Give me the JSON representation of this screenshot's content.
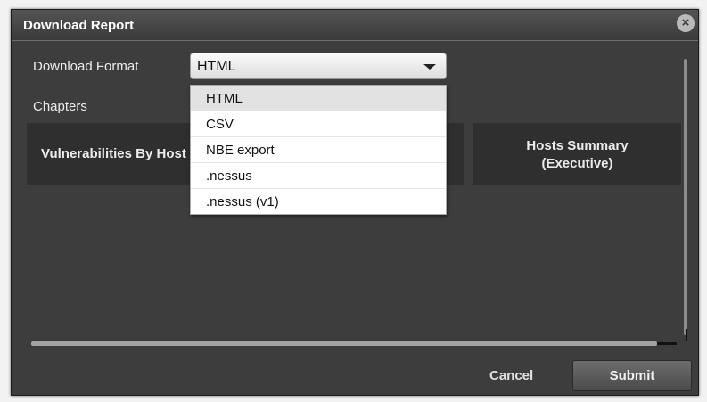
{
  "dialog": {
    "title": "Download Report",
    "close_icon": "close-icon",
    "close_glyph": "×"
  },
  "format": {
    "label": "Download Format",
    "selected": "HTML",
    "options": [
      "HTML",
      "CSV",
      "NBE export",
      ".nessus",
      ".nessus (v1)"
    ]
  },
  "chapters": {
    "label": "Chapters",
    "items": [
      {
        "label": "Vulnerabilities By Host"
      },
      {
        "line1": "Hosts Summary",
        "line2": "(Executive)"
      }
    ]
  },
  "footer": {
    "cancel_label": "Cancel",
    "submit_label": "Submit"
  },
  "colors": {
    "dialog_bg": "#3d3d3d",
    "chapter_bg": "#2f2f2f",
    "dropdown_selected": "#e2e2e2"
  }
}
